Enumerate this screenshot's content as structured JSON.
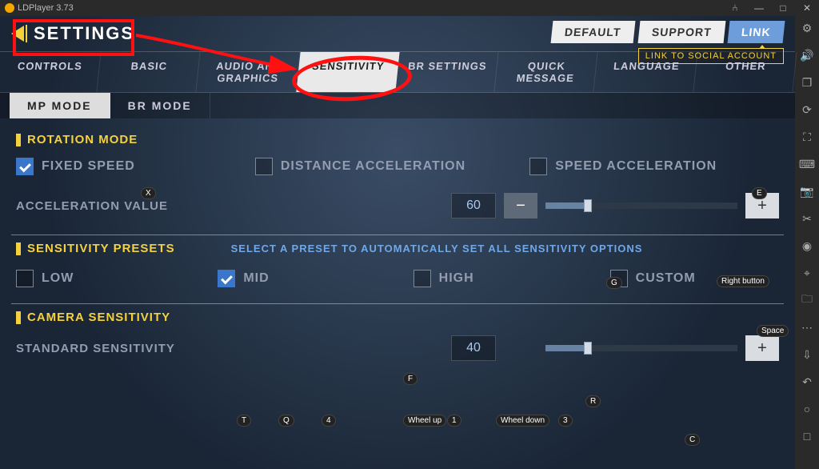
{
  "app": {
    "title": "LDPlayer 3.73"
  },
  "window": {
    "min": "—",
    "max": "□",
    "close": "✕",
    "lock": "⑃"
  },
  "sidebarIcons": [
    "gear",
    "volume",
    "multi",
    "rotate",
    "fullscreen",
    "keyboard",
    "camera",
    "scissors",
    "record",
    "location",
    "folder",
    "more",
    "install",
    "back"
  ],
  "header": {
    "back": "SETTINGS",
    "default": "DEFAULT",
    "support": "SUPPORT",
    "link": "LINK",
    "tooltip": "LINK TO SOCIAL ACCOUNT"
  },
  "tabs": [
    "CONTROLS",
    "BASIC",
    "AUDIO AND GRAPHICS",
    "SENSITIVITY",
    "BR SETTINGS",
    "QUICK MESSAGE",
    "LANGUAGE",
    "OTHER"
  ],
  "subtabs": {
    "mp": "MP MODE",
    "br": "BR MODE"
  },
  "rotation": {
    "title": "ROTATION MODE",
    "fixed": "FIXED SPEED",
    "dist": "DISTANCE ACCELERATION",
    "speed": "SPEED ACCELERATION",
    "accel_label": "ACCELERATION VALUE",
    "accel_value": "60",
    "accel_fill_pct": 20
  },
  "presets": {
    "title": "SENSITIVITY PRESETS",
    "hint": "SELECT A PRESET TO AUTOMATICALLY SET ALL SENSITIVITY OPTIONS",
    "low": "LOW",
    "mid": "MID",
    "high": "HIGH",
    "custom": "CUSTOM"
  },
  "camera": {
    "title": "CAMERA SENSITIVITY",
    "std_label": "STANDARD SENSITIVITY",
    "std_value": "40",
    "std_fill_pct": 20
  },
  "keys": {
    "x": "X",
    "e": "E",
    "g": "G",
    "right": "Right button",
    "space": "Space",
    "f": "F",
    "t": "T",
    "q": "Q",
    "k4": "4",
    "wu": "Wheel up",
    "k1": "1",
    "wd": "Wheel down",
    "k3": "3",
    "r": "R",
    "c": "C"
  }
}
